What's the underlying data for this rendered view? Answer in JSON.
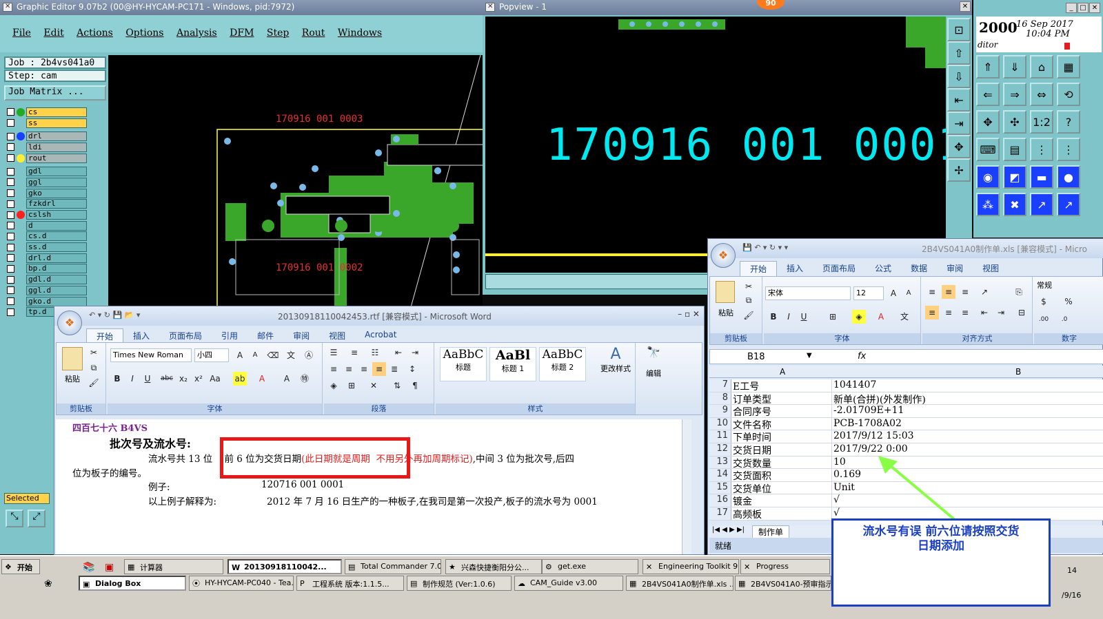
{
  "graphic_editor": {
    "title": "Graphic Editor 9.07b2 (00@HY-HYCAM-PC171 - Windows, pid:7972)",
    "menu": [
      "File",
      "Edit",
      "Actions",
      "Options",
      "Analysis",
      "DFM",
      "Step",
      "Rout",
      "Windows"
    ],
    "job": "Job : 2b4vs041a0",
    "step": "Step: cam",
    "job_matrix": "Job Matrix ...",
    "layers": [
      {
        "name": "cs",
        "style": "yel",
        "dot": "#22aa22"
      },
      {
        "name": "ss",
        "style": "yel",
        "dot": ""
      },
      {
        "name": "drl",
        "style": "gr",
        "dot": "#1a3fff"
      },
      {
        "name": "ldi",
        "style": "gr",
        "dot": ""
      },
      {
        "name": "rout",
        "style": "gr",
        "dot": "#ffee33"
      },
      {
        "name": "gdl",
        "style": "",
        "dot": ""
      },
      {
        "name": "ggl",
        "style": "",
        "dot": ""
      },
      {
        "name": "gko",
        "style": "",
        "dot": ""
      },
      {
        "name": "fzkdrl",
        "style": "",
        "dot": ""
      },
      {
        "name": "cslsh",
        "style": "",
        "dot": "#ff2020"
      },
      {
        "name": "d",
        "style": "",
        "dot": ""
      },
      {
        "name": "cs.d",
        "style": "",
        "dot": ""
      },
      {
        "name": "ss.d",
        "style": "",
        "dot": ""
      },
      {
        "name": "drl.d",
        "style": "",
        "dot": ""
      },
      {
        "name": "bp.d",
        "style": "",
        "dot": ""
      },
      {
        "name": "gdl.d",
        "style": "",
        "dot": ""
      },
      {
        "name": "ggl.d",
        "style": "",
        "dot": ""
      },
      {
        "name": "gko.d",
        "style": "",
        "dot": ""
      },
      {
        "name": "tp.d",
        "style": "",
        "dot": ""
      }
    ],
    "selected_label": "Selected",
    "canvas_text_1": "170916 001 0003",
    "canvas_text_2": "170916 001 0002"
  },
  "popview": {
    "title": "Popview - 1",
    "badge": "90",
    "big_text": "170916 001 0001"
  },
  "right_panel": {
    "year": "2000",
    "date": "16 Sep 2017",
    "time": "10:04 PM",
    "editor": "ditor",
    "tool_icons": [
      "layer-up-icon",
      "layer-down-icon",
      "home-icon",
      "frame-icon",
      "move-left-icon",
      "move-right-icon",
      "swap-icon",
      "step-icon",
      "fit-icon",
      "center-icon",
      "scale-icon",
      "help-icon",
      "grid-icon",
      "blank-icon",
      "net-icon",
      "net2-icon",
      "drill-icon",
      "measure-icon",
      "ruler-icon",
      "dot-icon",
      "node-icon",
      "cross-icon",
      "arrow-icon",
      "arrow2-icon"
    ]
  },
  "word": {
    "title": "20130918110042453.rtf [兼容模式] - Microsoft Word",
    "tabs": [
      "开始",
      "插入",
      "页面布局",
      "引用",
      "邮件",
      "审阅",
      "视图",
      "Acrobat"
    ],
    "font_name": "Times New Roman",
    "font_size": "小四",
    "groups": [
      "剪贴板",
      "字体",
      "段落",
      "样式",
      "编辑"
    ],
    "paste": "粘贴",
    "styles": [
      {
        "sample": "AaBbC",
        "name": "标题"
      },
      {
        "sample": "AaBl",
        "name": "标题 1"
      },
      {
        "sample": "AaBbC",
        "name": "标题 2"
      }
    ],
    "change_style": "更改样式",
    "edit": "编辑",
    "doc": {
      "line0": "四百七十六  B4VS",
      "heading": "批次号及流水号:",
      "p1a": "流水号共 13 位",
      "p1b": "前 6 位为交货日期",
      "p1c": "(此日期就是周期",
      "p1d": "不用另外再加周期标记)",
      "p1e": ",中间 3 位为批次号,后四",
      "p2": "位为板子的编号。",
      "p3a": "例子:",
      "p3b": "120716 001 0001",
      "p4a": "以上例子解释为:",
      "p4b": "2012 年 7 月 16 日生产的一种板子,在我司是第一次投产,板子的流水号为 0001"
    }
  },
  "excel": {
    "title": "2B4VS041A0制作单.xls [兼容模式] - Micro",
    "tabs": [
      "开始",
      "插入",
      "页面布局",
      "公式",
      "数据",
      "审阅",
      "视图"
    ],
    "font_name": "宋体",
    "font_size": "12",
    "groups": [
      "剪贴板",
      "字体",
      "对齐方式",
      "数字"
    ],
    "paste": "粘贴",
    "number_format": "常规",
    "cell_ref": "B18",
    "fx": "fx",
    "col_a": "A",
    "col_b": "B",
    "rows": [
      {
        "n": "7",
        "a": "E工号",
        "b": "1041407"
      },
      {
        "n": "8",
        "a": "订单类型",
        "b": "新单(合拼)(外发制作)"
      },
      {
        "n": "9",
        "a": "合同序号",
        "b": "-2.01709E+11"
      },
      {
        "n": "10",
        "a": "文件名称",
        "b": "PCB-1708A02"
      },
      {
        "n": "11",
        "a": "下单时间",
        "b": "2017/9/12 15:03"
      },
      {
        "n": "12",
        "a": "交货日期",
        "b": "2017/9/22 0:00"
      },
      {
        "n": "13",
        "a": "交货数量",
        "b": "10"
      },
      {
        "n": "14",
        "a": "交货面积",
        "b": "0.169"
      },
      {
        "n": "15",
        "a": "交货单位",
        "b": "Unit"
      },
      {
        "n": "16",
        "a": "镀金",
        "b": "√"
      },
      {
        "n": "17",
        "a": "高频板",
        "b": "√"
      }
    ],
    "sheet_tab": "制作单",
    "status": "就绪"
  },
  "note": {
    "line1": "流水号有误  前六位请按照交货",
    "line2": "日期添加",
    "color": "#1a3fc0"
  },
  "taskbar": {
    "start": "开始",
    "row1": [
      "计算器",
      "20130918110042...",
      "Total Commander 7.0...",
      "兴森快捷衡阳分公...",
      "get.exe",
      "Engineering Toolkit 9....",
      "Progress"
    ],
    "row2": [
      "Dialog Box",
      "HY-HYCAM-PC040 - Tea...",
      "工程系统  版本:1.1.5...",
      "制作规范 (Ver:1.0.6)",
      "CAM_Guide v3.00",
      "2B4VS041A0制作单.xls ...",
      "2B4VS041A0-预审指示..."
    ],
    "clock1": "14",
    "clock2": "/9/16"
  }
}
